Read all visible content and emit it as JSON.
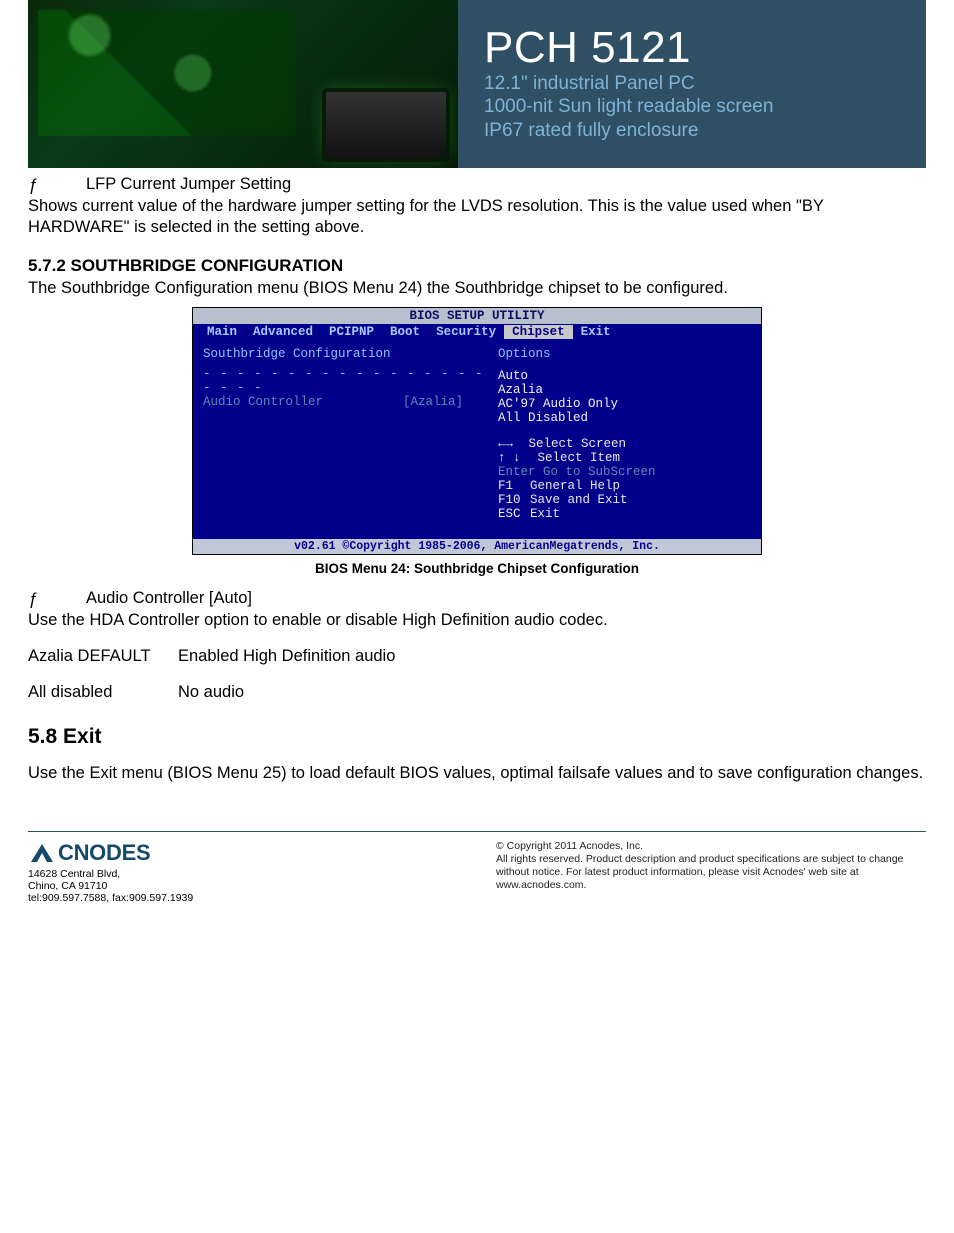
{
  "banner": {
    "title": "PCH 5121",
    "sub1": "12.1\" industrial Panel PC",
    "sub2": "1000-nit Sun light readable screen",
    "sub3": "IP67 rated fully enclosure"
  },
  "section1": {
    "bullet_sym": "ƒ",
    "bullet_label": "LFP Current Jumper Setting",
    "para": "Shows current value of the hardware jumper setting for the LVDS resolution. This is the value used when \"BY HARDWARE\" is selected in the setting above."
  },
  "sec572": {
    "heading": "5.7.2  SOUTHBRIDGE CONFIGURATION",
    "para": "The Southbridge Configuration menu (BIOS Menu 24) the Southbridge chipset to be configured."
  },
  "bios": {
    "title": "BIOS SETUP UTILITY",
    "menu": [
      "Main",
      "Advanced",
      "PCIPNP",
      "Boot",
      "Security",
      "Chipset",
      "Exit"
    ],
    "selected_menu": "Chipset",
    "left_header": "Southbridge Configuration",
    "left_row_key": "Audio Controller",
    "left_row_val": "[Azalia]",
    "right_header": "Options",
    "options": [
      "Auto",
      "Azalia",
      "AC'97 Audio Only",
      "All Disabled"
    ],
    "nav": {
      "select_screen": "Select Screen",
      "select_item": "Select Item",
      "enter": "Enter Go to SubScreen",
      "f1": "General Help",
      "f10": "Save and Exit",
      "esc": "Exit"
    },
    "footer": "v02.61 ©Copyright 1985-2006, AmericanMegatrends, Inc.",
    "caption": "BIOS Menu 24: Southbridge Chipset Configuration"
  },
  "audio": {
    "bullet_sym": "ƒ",
    "bullet_label": "Audio Controller [Auto]",
    "para": "Use the HDA Controller option to enable or disable High Definition audio codec.",
    "rows": [
      {
        "k": "Azalia DEFAULT",
        "v": "Enabled High Definition audio"
      },
      {
        "k": "All disabled",
        "v": "No audio"
      }
    ]
  },
  "sec58": {
    "heading": "5.8 Exit",
    "para": "Use the Exit menu (BIOS Menu 25) to load default BIOS values, optimal failsafe values and to save configuration changes."
  },
  "footer": {
    "brand": "CNODES",
    "addr1": "14628 Central Blvd,",
    "addr2": "Chino, CA 91710",
    "tel": "tel:909.597.7588, fax:909.597.1939",
    "copy": "© Copyright 2011 Acnodes, Inc.",
    "legal": "All rights reserved. Product description and product specifications are subject to change without notice. For latest product information, please visit Acnodes' web site at www.acnodes.com."
  }
}
